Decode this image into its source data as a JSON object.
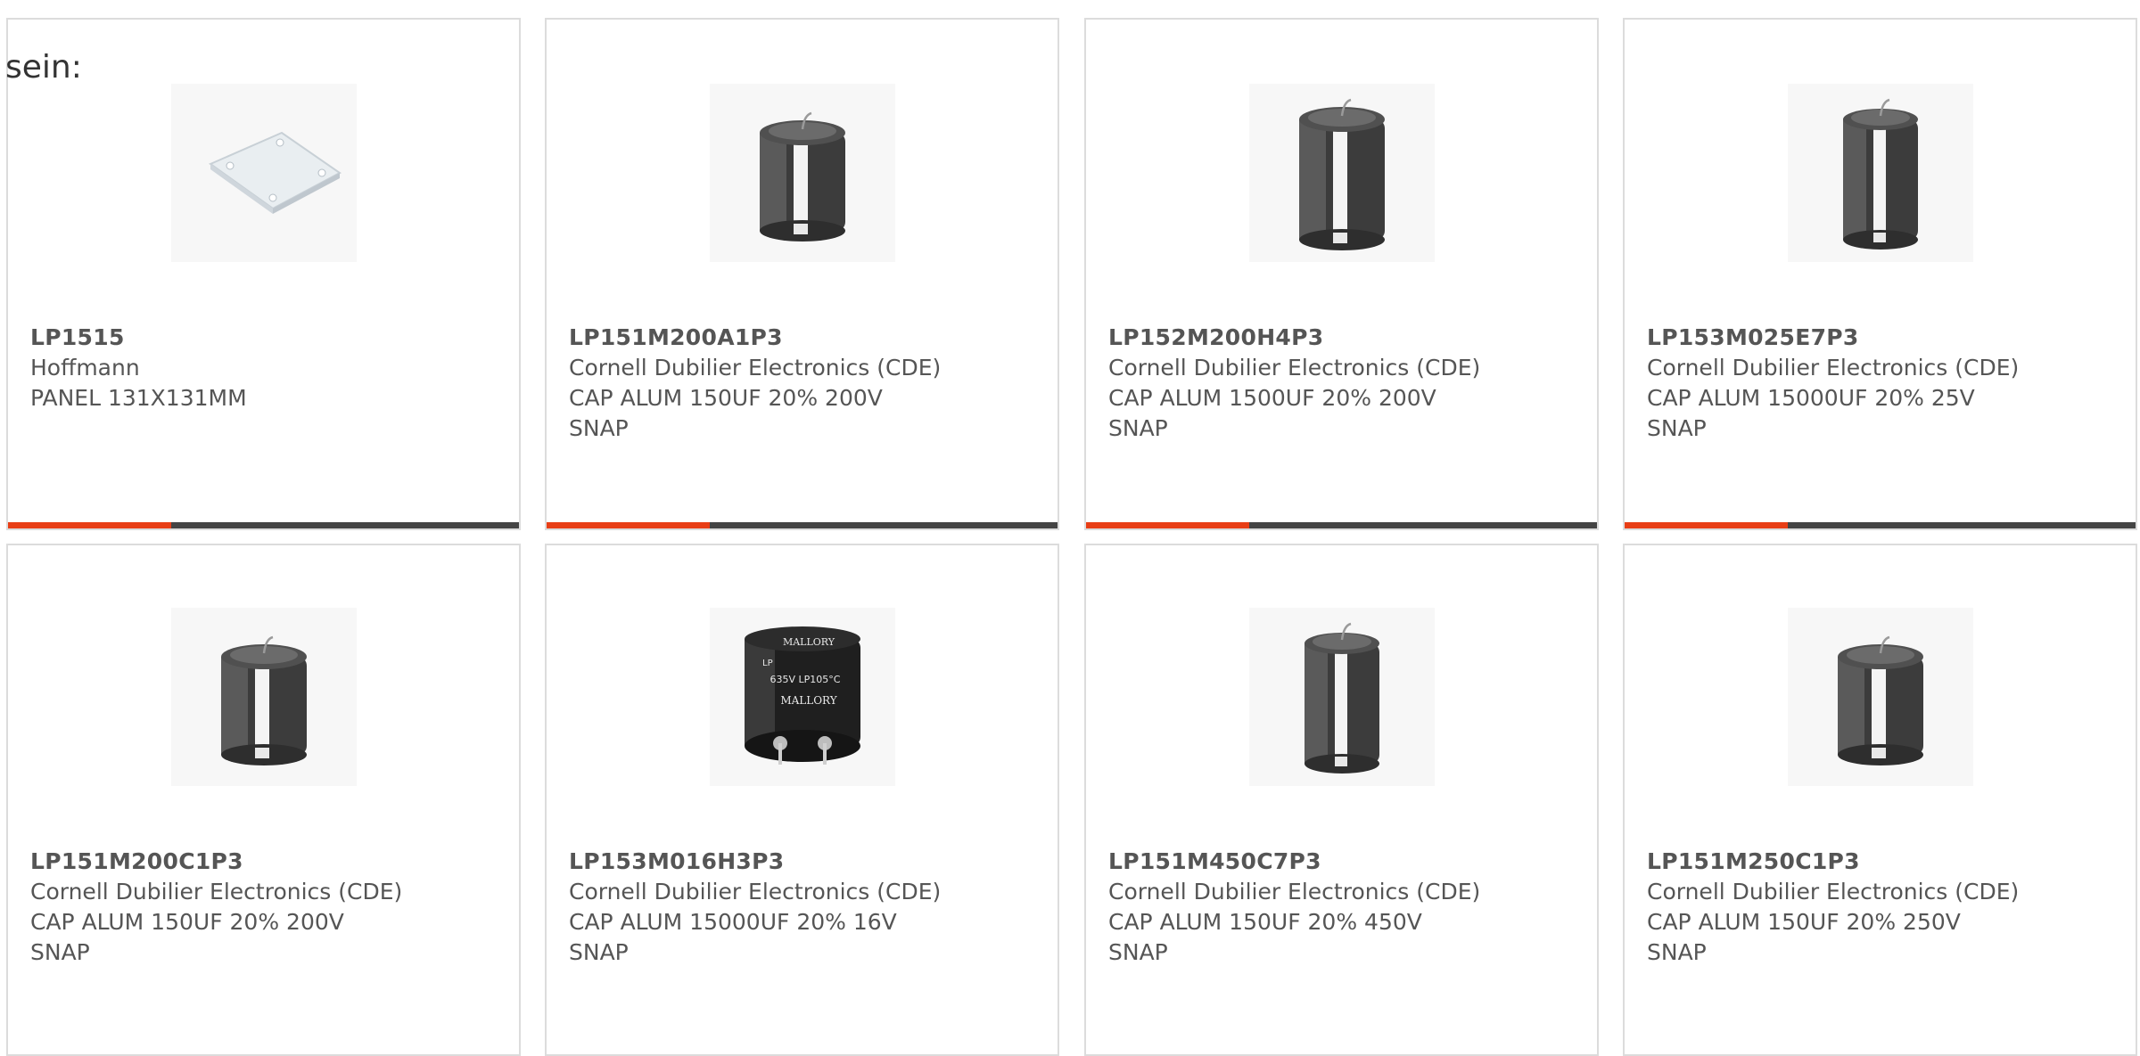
{
  "heading_fragment": "sein:",
  "colors": {
    "accent": "#e83e16",
    "bar_track": "#444444",
    "card_border": "#dcdcdc",
    "text": "#555555"
  },
  "products": [
    {
      "part_number": "LP1515",
      "manufacturer": "Hoffmann",
      "description": "PANEL 131X131MM",
      "image": "panel-plate-image",
      "has_bar": true
    },
    {
      "part_number": "LP151M200A1P3",
      "manufacturer": "Cornell Dubilier Electronics (CDE)",
      "description": "CAP ALUM 150UF 20% 200V\nSNAP",
      "image": "capacitor-image",
      "has_bar": true
    },
    {
      "part_number": "LP152M200H4P3",
      "manufacturer": "Cornell Dubilier Electronics (CDE)",
      "description": "CAP ALUM 1500UF 20% 200V\nSNAP",
      "image": "capacitor-image",
      "has_bar": true
    },
    {
      "part_number": "LP153M025E7P3",
      "manufacturer": "Cornell Dubilier Electronics (CDE)",
      "description": "CAP ALUM 15000UF 20% 25V\nSNAP",
      "image": "capacitor-image",
      "has_bar": true
    },
    {
      "part_number": "LP151M200C1P3",
      "manufacturer": "Cornell Dubilier Electronics (CDE)",
      "description": "CAP ALUM 150UF 20% 200V\nSNAP",
      "image": "capacitor-image",
      "has_bar": false
    },
    {
      "part_number": "LP153M016H3P3",
      "manufacturer": "Cornell Dubilier Electronics (CDE)",
      "description": "CAP ALUM 15000UF 20% 16V\nSNAP",
      "image": "mallory-capacitor-image",
      "image_text": [
        "MALLORY",
        "LP",
        "635V LP105°C",
        "MALLORY"
      ],
      "has_bar": false
    },
    {
      "part_number": "LP151M450C7P3",
      "manufacturer": "Cornell Dubilier Electronics (CDE)",
      "description": "CAP ALUM 150UF 20% 450V\nSNAP",
      "image": "capacitor-image",
      "has_bar": false
    },
    {
      "part_number": "LP151M250C1P3",
      "manufacturer": "Cornell Dubilier Electronics (CDE)",
      "description": "CAP ALUM 150UF 20% 250V\nSNAP",
      "image": "capacitor-image",
      "has_bar": false
    }
  ]
}
